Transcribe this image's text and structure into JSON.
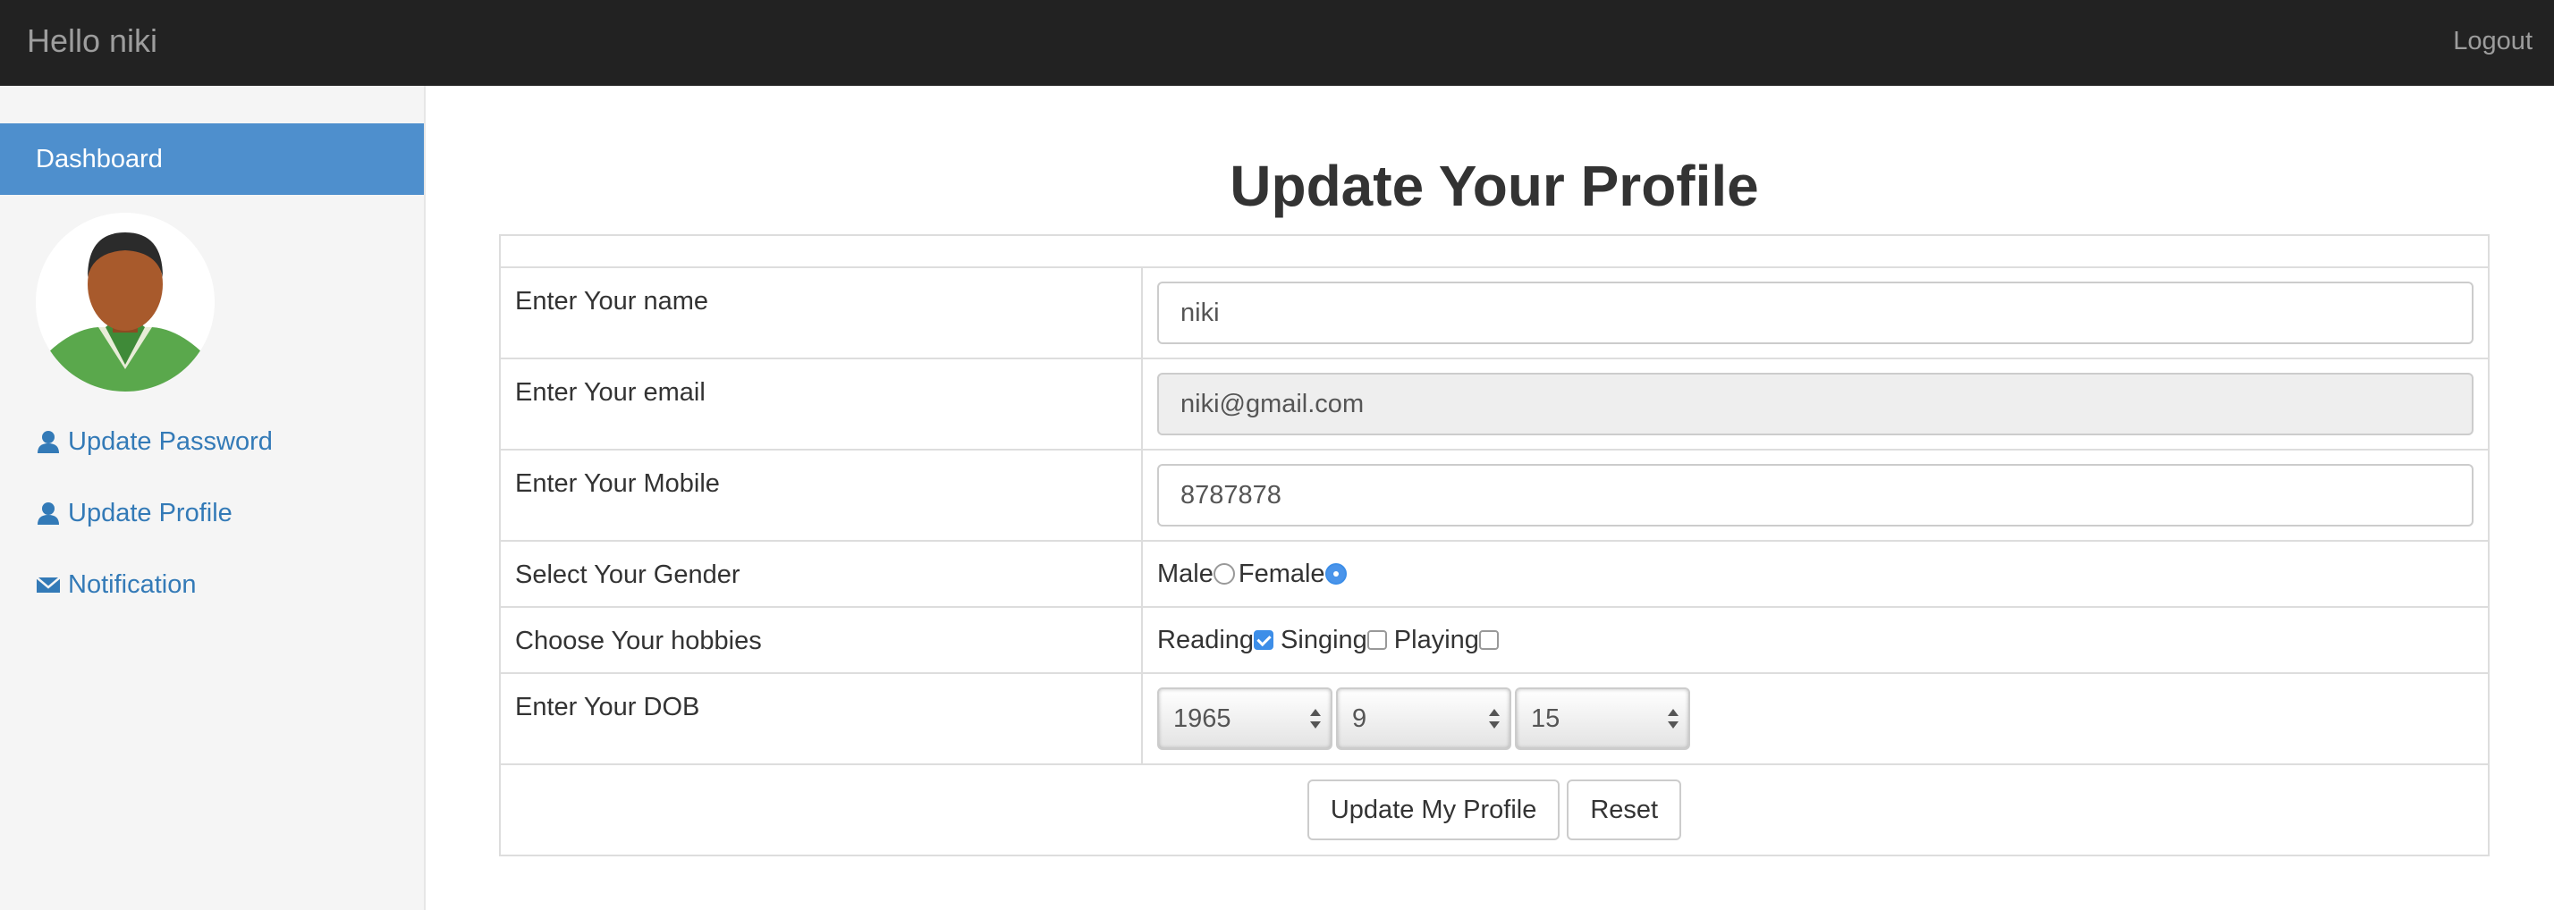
{
  "topbar": {
    "brand": "Hello niki",
    "logout": "Logout"
  },
  "sidebar": {
    "dashboard": "Dashboard",
    "links": [
      {
        "label": "Update Password",
        "icon": "user-icon"
      },
      {
        "label": "Update Profile",
        "icon": "user-icon"
      },
      {
        "label": "Notification",
        "icon": "envelope-icon"
      }
    ]
  },
  "main": {
    "title": "Update Your Profile",
    "form": {
      "name_label": "Enter Your name",
      "name_value": "niki",
      "email_label": "Enter Your email",
      "email_value": "niki@gmail.com",
      "mobile_label": "Enter Your Mobile",
      "mobile_value": "8787878",
      "gender_label": "Select Your Gender",
      "gender_options": [
        "Male",
        "Female"
      ],
      "gender_selected": "Female",
      "hobbies_label": "Choose Your hobbies",
      "hobbies": [
        {
          "label": "Reading",
          "checked": true
        },
        {
          "label": "Singing",
          "checked": false
        },
        {
          "label": "Playing",
          "checked": false
        }
      ],
      "dob_label": "Enter Your DOB",
      "dob_year": "1965",
      "dob_month": "9",
      "dob_day": "15",
      "submit_label": "Update My Profile",
      "reset_label": "Reset"
    }
  },
  "colors": {
    "topbar": "#222222",
    "accent": "#4e8fcd",
    "link": "#337ab7",
    "check": "#3d8ee8"
  }
}
